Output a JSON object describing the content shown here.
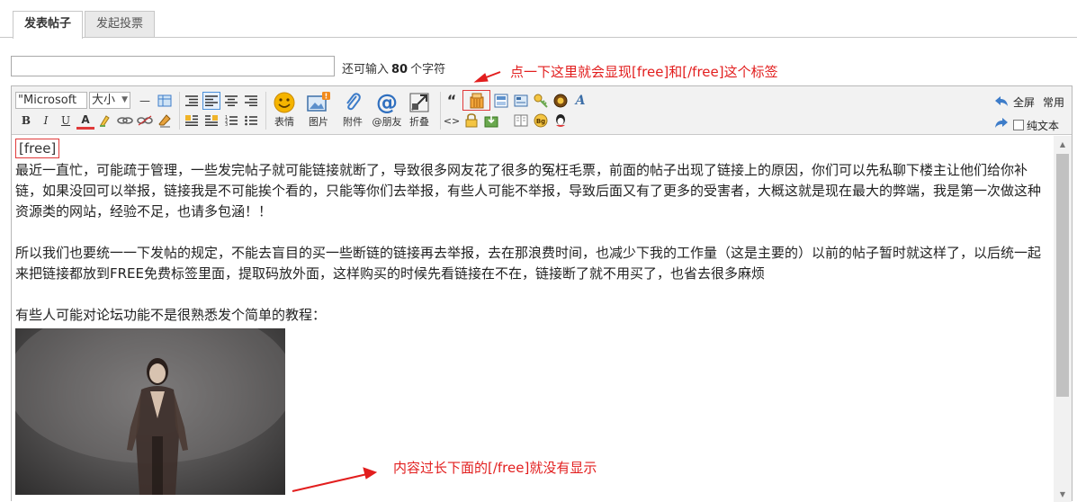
{
  "tabs": [
    {
      "label": "发表帖子",
      "active": true
    },
    {
      "label": "发起投票",
      "active": false
    }
  ],
  "subject": {
    "value": "",
    "counter_prefix": "还可输入",
    "counter_value": "80",
    "counter_suffix": "个字符"
  },
  "annotations": {
    "top": "点一下这里就会显现[free]和[/free]这个标签",
    "bottom": "内容过长下面的[/free]就没有显示",
    "color": "#e21e1e"
  },
  "toolbar": {
    "font_select": "\"Microsoft",
    "size_select": "大小",
    "format_buttons": {
      "bold": "B",
      "italic": "I",
      "underline": "U",
      "font_color": "A"
    },
    "big_buttons": [
      {
        "label": "表情",
        "icon": "smiley-icon"
      },
      {
        "label": "图片",
        "icon": "image-icon"
      },
      {
        "label": "附件",
        "icon": "paperclip-icon"
      },
      {
        "label": "@朋友",
        "icon": "at-icon"
      },
      {
        "label": "折叠",
        "icon": "fold-icon"
      }
    ],
    "quote_glyph": "“",
    "code_glyph": "<>",
    "right": {
      "fullscreen": "全屏",
      "common": "常用",
      "plain_text": "纯文本"
    }
  },
  "content": {
    "free_tag": "[free]",
    "paragraphs": [
      "最近一直忙，可能疏于管理，一些发完帖子就可能链接就断了，导致很多网友花了很多的冤枉毛票，前面的帖子出现了链接上的原因，你们可以先私聊下楼主让他们给你补链，如果没回可以举报，链接我是不可能挨个看的，只能等你们去举报，有些人可能不举报，导致后面又有了更多的受害者，大概这就是现在最大的弊端，我是第一次做这种资源类的网站，经验不足，也请多包涵！！",
      "所以我们也要统一一下发帖的规定，不能去盲目的买一些断链的链接再去举报，去在那浪费时间，也减少下我的工作量（这是主要的）以前的帖子暂时就这样了，以后统一起来把链接都放到FREE免费标签里面，提取码放外面，这样购买的时候先看链接在不在，链接断了就不用买了，也省去很多麻烦",
      "有些人可能对论坛功能不是很熟悉发个简单的教程："
    ]
  }
}
